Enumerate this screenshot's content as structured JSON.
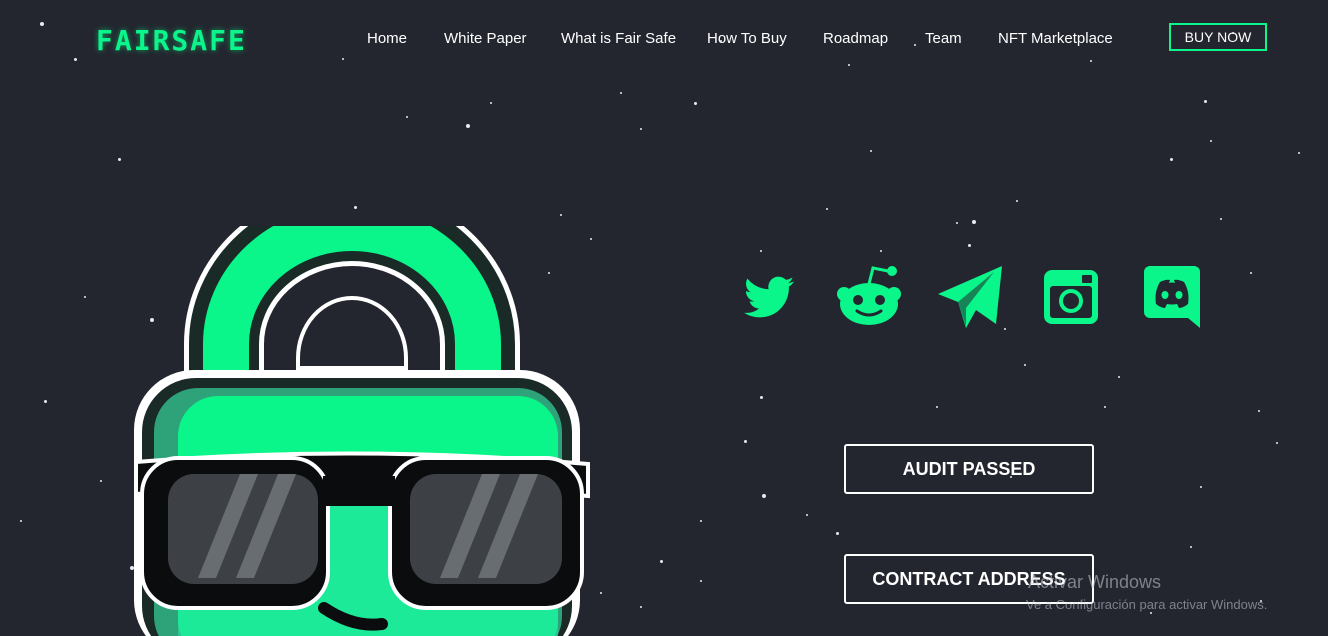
{
  "brand": {
    "logo_text": "FAIRSAFE",
    "accent_color": "#0af58a",
    "background_color": "#23262f"
  },
  "nav": {
    "items": [
      {
        "label": "Home"
      },
      {
        "label": "White Paper"
      },
      {
        "label": "What is Fair Safe"
      },
      {
        "label": "How To Buy"
      },
      {
        "label": "Roadmap"
      },
      {
        "label": "Team"
      },
      {
        "label": "NFT Marketplace"
      }
    ],
    "buy_label": "BUY NOW"
  },
  "social": [
    {
      "icon": "twitter-icon"
    },
    {
      "icon": "reddit-icon"
    },
    {
      "icon": "telegram-icon"
    },
    {
      "icon": "instagram-icon"
    },
    {
      "icon": "discord-icon"
    }
  ],
  "actions": {
    "audit_label": "AUDIT PASSED",
    "contract_label": "CONTRACT ADDRESS"
  },
  "mascot": {
    "icon": "padlock-mascot-with-sunglasses"
  },
  "watermark": {
    "title": "Activar Windows",
    "subtitle": "Ve a Configuración para activar Windows."
  }
}
